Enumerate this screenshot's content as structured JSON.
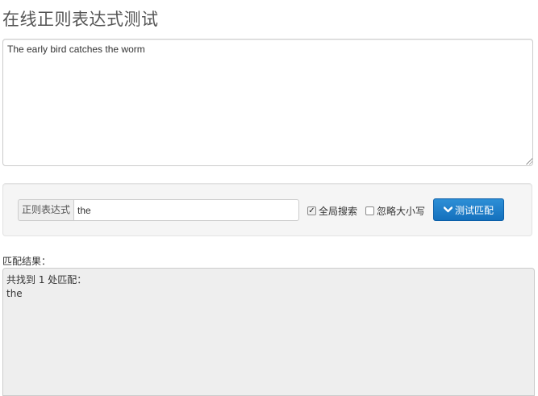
{
  "page": {
    "title": "在线正则表达式测试"
  },
  "source": {
    "text": "The early bird catches the worm"
  },
  "controls": {
    "regex_label": "正则表达式",
    "regex_value": "the",
    "global_search_label": "全局搜索",
    "global_search_checked": true,
    "ignore_case_label": "忽略大小写",
    "ignore_case_checked": false,
    "test_button_label": "测试匹配",
    "test_button_icon": "chevron-down-icon",
    "accent_color": "#1470bd"
  },
  "result": {
    "label": "匹配结果：",
    "summary": "共找到 1 处匹配：",
    "matches": [
      "the"
    ]
  }
}
